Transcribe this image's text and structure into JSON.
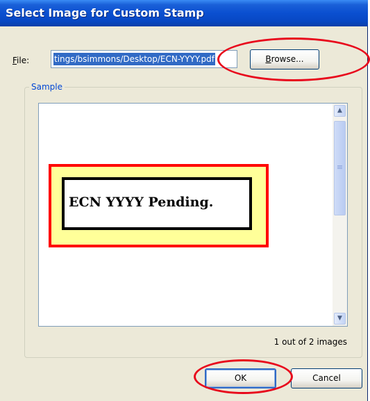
{
  "window": {
    "title": "Select Image for Custom Stamp"
  },
  "file": {
    "label_prefix": "",
    "label_mnemonic": "F",
    "label_rest": "ile:",
    "value": "tings/bsimmons/Desktop/ECN-YYYY.pdf"
  },
  "browse_button": {
    "mnemonic": "B",
    "label_rest": "rowse..."
  },
  "sample": {
    "legend": "Sample",
    "stamp_text": "ECN YYYY Pending.",
    "image_count": "1 out of 2 images"
  },
  "buttons": {
    "ok": "OK",
    "cancel": "Cancel"
  },
  "colors": {
    "title_bar": "#0a4fd0",
    "stamp_border": "#ff0000",
    "stamp_fill": "#ffff99",
    "annotation": "#e8081c",
    "selection": "#316ac5"
  },
  "icons": {
    "scroll_up": "chevron-up-icon",
    "scroll_down": "chevron-down-icon"
  }
}
